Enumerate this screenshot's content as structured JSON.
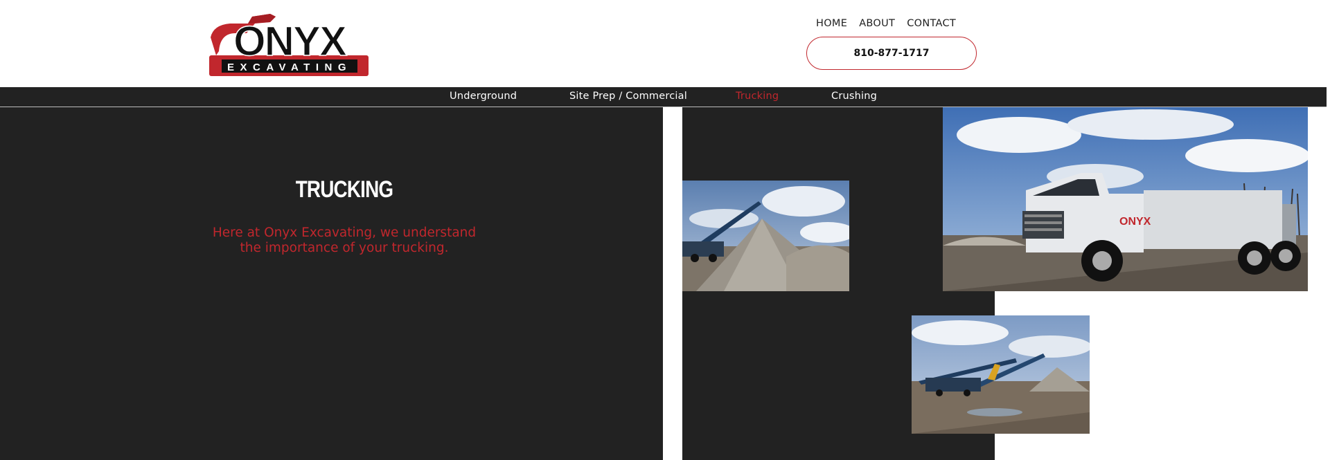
{
  "brand": {
    "logo_word": "ONYX",
    "logo_subword": "EXCAVATING",
    "colors": {
      "red": "#c1272d",
      "dark": "#222222"
    }
  },
  "top_nav": [
    {
      "label": "HOME"
    },
    {
      "label": "ABOUT"
    },
    {
      "label": "CONTACT"
    }
  ],
  "phone": {
    "label": "810-877-1717"
  },
  "service_nav": [
    {
      "label": "Underground",
      "active": false
    },
    {
      "label": "Site Prep / Commercial",
      "active": false
    },
    {
      "label": "Trucking",
      "active": true
    },
    {
      "label": "Crushing",
      "active": false
    }
  ],
  "main": {
    "title": "TRUCKING",
    "intro": "Here at Onyx Excavating, we understand the importance of your trucking."
  },
  "photos": [
    {
      "subject": "conveyor stacker and gravel pile"
    },
    {
      "subject": "white ONYX service truck"
    },
    {
      "subject": "crushing equipment on work site"
    }
  ]
}
